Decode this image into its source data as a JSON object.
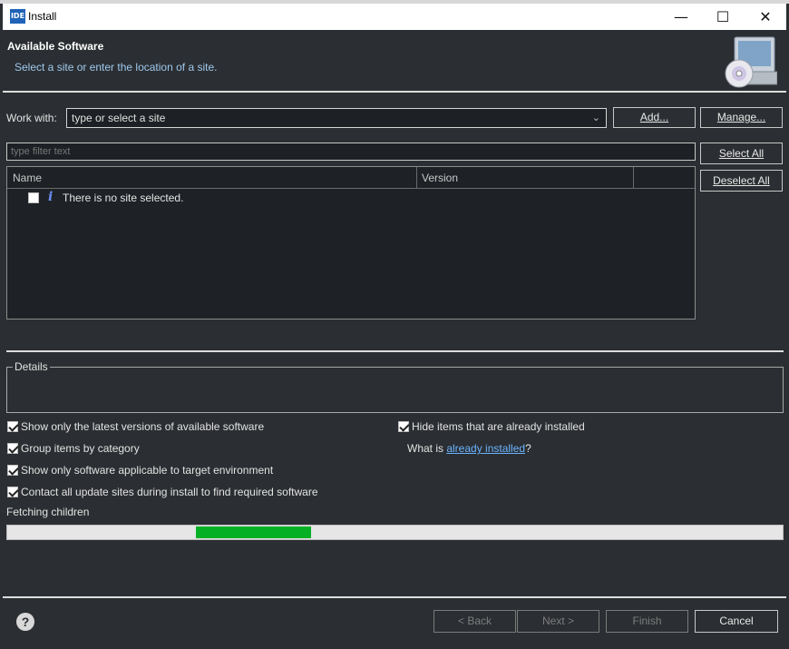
{
  "window": {
    "icon_text": "IDE",
    "title": "Install"
  },
  "header": {
    "title": "Available Software",
    "subtitle": "Select a site or enter the location of a site."
  },
  "work_with": {
    "label": "Work with:",
    "value": "type or select a site",
    "add_label": "Add...",
    "manage_label": "Manage..."
  },
  "filter": {
    "placeholder": "type filter text"
  },
  "buttons": {
    "select_all": "Select All",
    "deselect_all": "Deselect All"
  },
  "tree": {
    "columns": [
      "Name",
      "Version"
    ],
    "items": [
      {
        "label": "There is no site selected.",
        "checked": false
      }
    ]
  },
  "details": {
    "legend": "Details"
  },
  "options": {
    "latest_versions": {
      "label": "Show only the latest versions of available software",
      "checked": true
    },
    "group_by_category": {
      "label": "Group items by category",
      "checked": true
    },
    "target_env": {
      "label": "Show only software applicable to target environment",
      "checked": true
    },
    "contact_sites": {
      "label": "Contact all update sites during install to find required software",
      "checked": true
    },
    "hide_installed": {
      "label": "Hide items that are already installed",
      "checked": true
    },
    "already_installed_prefix": "What is ",
    "already_installed_link": "already installed",
    "already_installed_suffix": "?"
  },
  "status": {
    "text": "Fetching children"
  },
  "footer": {
    "back": "< Back",
    "next": "Next >",
    "finish": "Finish",
    "cancel": "Cancel"
  },
  "colors": {
    "progress": "#06b025",
    "link": "#6ab4ff",
    "background": "#2b2e32"
  },
  "icons": [
    "ide-app-icon",
    "minimize-icon",
    "maximize-icon",
    "close-icon",
    "install-wizard-icon",
    "info-icon",
    "help-icon"
  ]
}
